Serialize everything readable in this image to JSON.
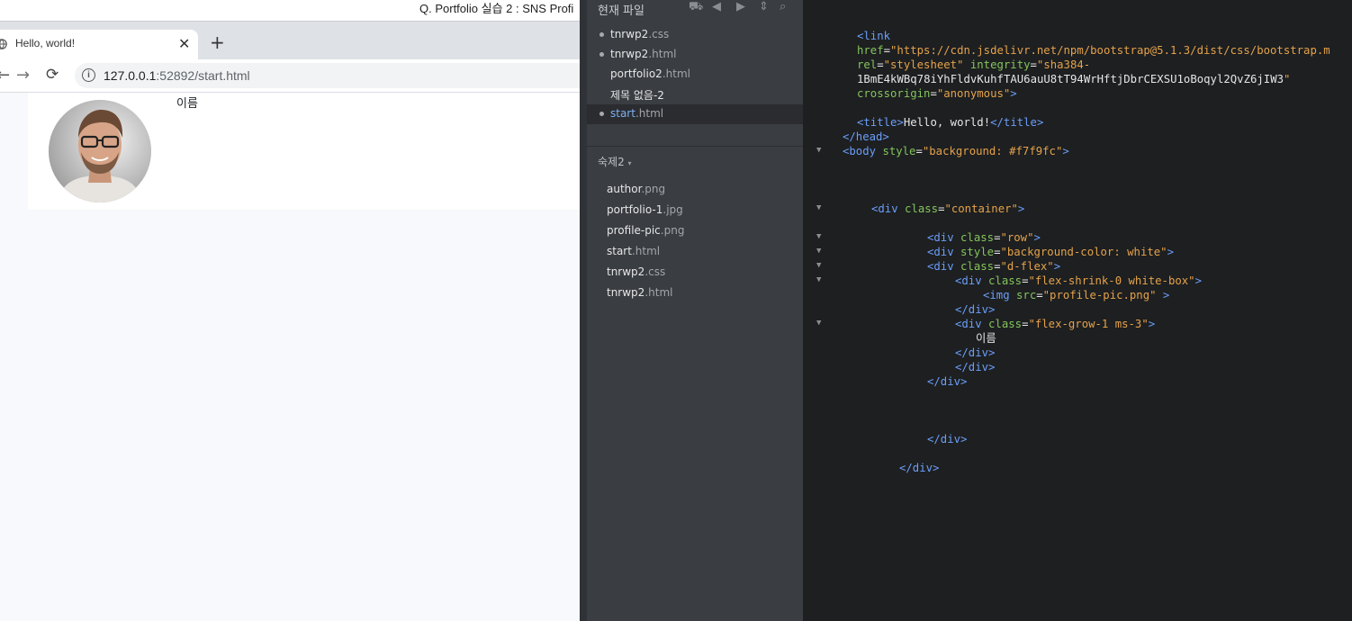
{
  "browser": {
    "window_title": "Q. Portfolio 실습 2 : SNS Profi",
    "tab_title": "Hello, world!",
    "tab_close": "✕",
    "new_tab": "+",
    "nav": {
      "back": "←",
      "forward": "→",
      "reload": "⟳",
      "info": "i"
    },
    "url_host": "127.0.0.1",
    "url_rest": ":52892/start.html",
    "page": {
      "name_label": "이름"
    }
  },
  "sidebar": {
    "header": "현재 파일",
    "open_files": [
      {
        "name": "tnrwp2",
        "ext": ".css",
        "dot": true,
        "active": false
      },
      {
        "name": "tnrwp2",
        "ext": ".html",
        "dot": true,
        "active": false
      },
      {
        "name": "portfolio2",
        "ext": ".html",
        "dot": false,
        "active": false
      },
      {
        "name": "제목 없음-2",
        "ext": "",
        "dot": false,
        "active": false
      },
      {
        "name": "start",
        "ext": ".html",
        "dot": true,
        "active": true
      }
    ],
    "project_title": "숙제2",
    "project_caret": "▾",
    "project_files": [
      {
        "name": "author",
        "ext": ".png"
      },
      {
        "name": "portfolio-1",
        "ext": ".jpg"
      },
      {
        "name": "profile-pic",
        "ext": ".png"
      },
      {
        "name": "start",
        "ext": ".html"
      },
      {
        "name": "tnrwp2",
        "ext": ".css"
      },
      {
        "name": "tnrwp2",
        "ext": ".html"
      }
    ]
  },
  "code": {
    "fold_marker": "▼",
    "lines": [
      "<link",
      "href=\"https://cdn.jsdelivr.net/npm/bootstrap@5.1.3/dist/css/bootstrap.m",
      "rel=\"stylesheet\" integrity=\"sha384-",
      "1BmE4kWBq78iYhFldvKuhfTAU6auU8tT94WrHftjDbrCEXSU1oBoqyl2QvZ6jIW3\"",
      "crossorigin=\"anonymous\">",
      "<title>Hello, world!</title>",
      "</head>",
      "<body style=\"background: #f7f9fc\">",
      "<div class=\"container\">",
      "<div class=\"row\">",
      "<div style=\"background-color: white\">",
      "<div class=\"d-flex\">",
      "<div class=\"flex-shrink-0 white-box\">",
      "<img src=\"profile-pic.png\" >",
      "</div>",
      "<div class=\"flex-grow-1 ms-3\">",
      "이름",
      "</div>",
      "</div>",
      "</div>",
      "</div>",
      "</div>"
    ]
  }
}
